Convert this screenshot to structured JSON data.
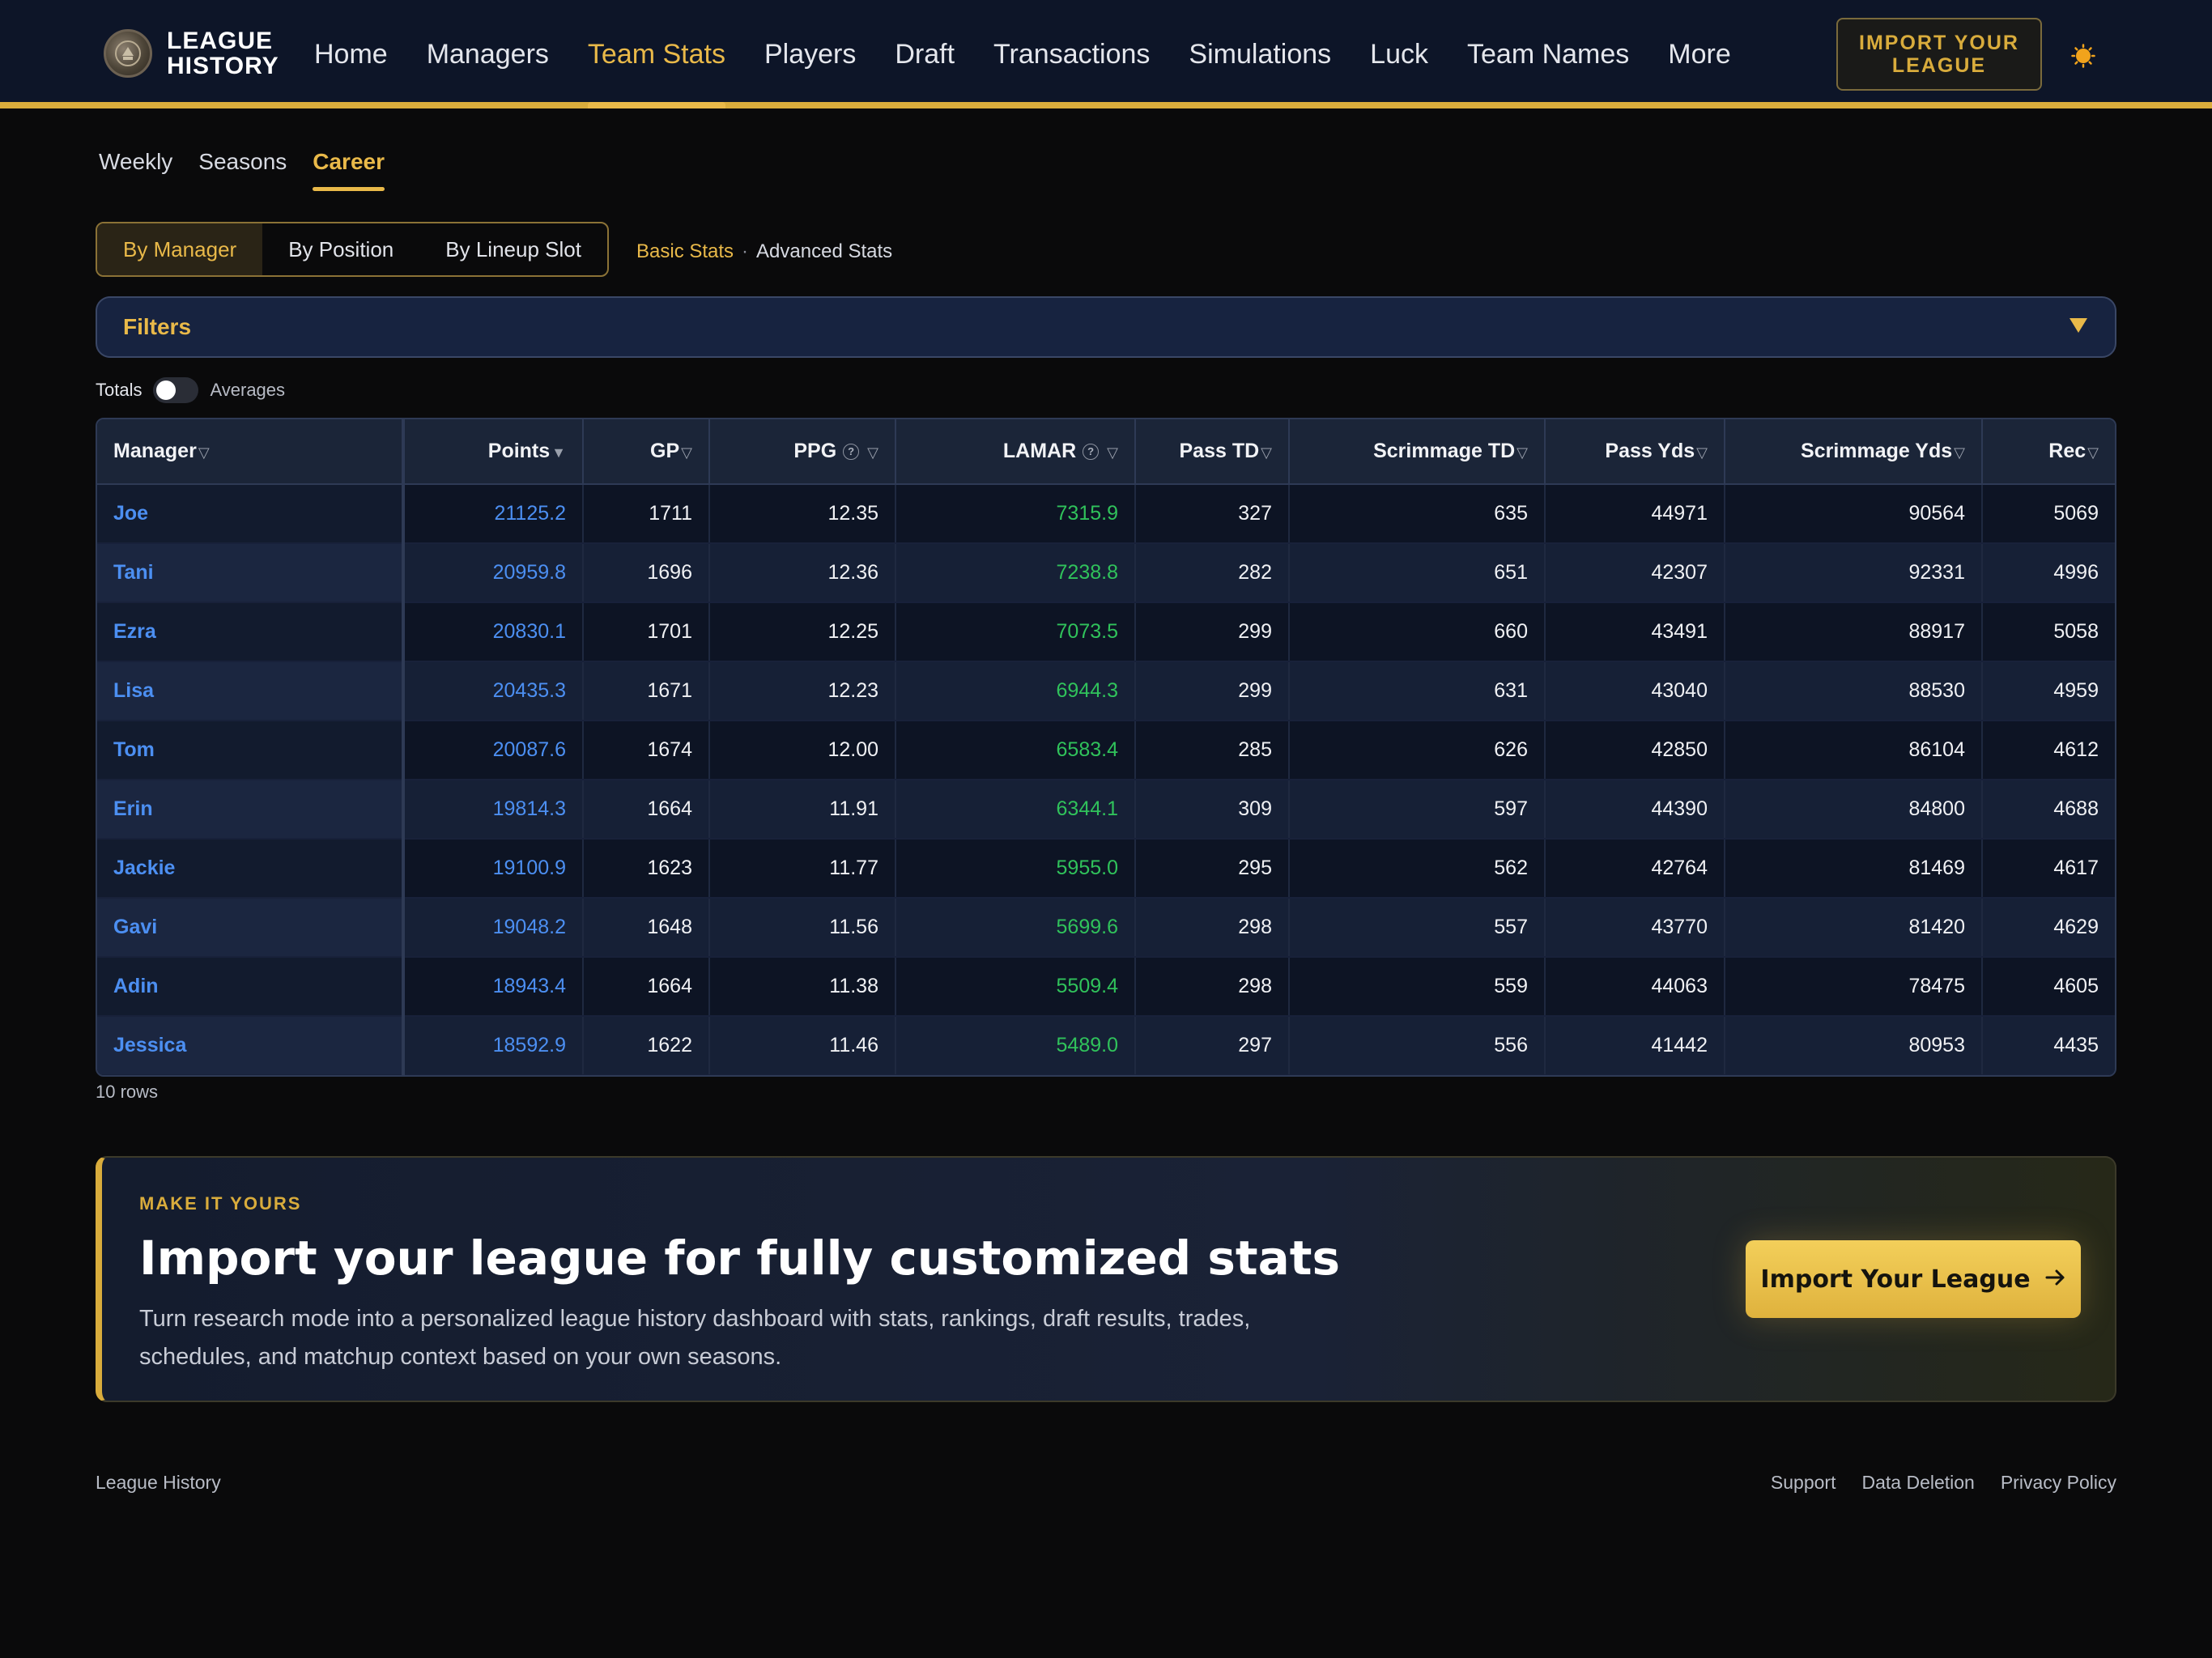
{
  "brand": {
    "name": "LEAGUE HISTORY",
    "logo_icon": "seal-logo-icon"
  },
  "nav": {
    "links": [
      "Home",
      "Managers",
      "Team Stats",
      "Players",
      "Draft",
      "Transactions",
      "Simulations",
      "Luck",
      "Team Names",
      "More"
    ],
    "active": "Team Stats",
    "import_label": "IMPORT YOUR LEAGUE",
    "theme_icon": "sun-icon"
  },
  "subtabs": {
    "items": [
      "Weekly",
      "Seasons",
      "Career"
    ],
    "active": "Career"
  },
  "segment": {
    "items": [
      "By Manager",
      "By Position",
      "By Lineup Slot"
    ],
    "active": "By Manager"
  },
  "stat_links": {
    "basic": "Basic Stats",
    "separator": "·",
    "advanced": "Advanced Stats",
    "active": "Basic Stats"
  },
  "filters": {
    "label": "Filters",
    "icon": "caret-down-icon"
  },
  "toggle": {
    "left": "Totals",
    "right": "Averages",
    "state": "Totals"
  },
  "table": {
    "headers": [
      "Manager",
      "Points",
      "GP",
      "PPG",
      "LAMAR",
      "Pass TD",
      "Scrimmage TD",
      "Pass Yds",
      "Scrimmage Yds",
      "Rec"
    ],
    "rows": [
      [
        "Joe",
        "21125.2",
        "1711",
        "12.35",
        "7315.9",
        "327",
        "635",
        "44971",
        "90564",
        "5069"
      ],
      [
        "Tani",
        "20959.8",
        "1696",
        "12.36",
        "7238.8",
        "282",
        "651",
        "42307",
        "92331",
        "4996"
      ],
      [
        "Ezra",
        "20830.1",
        "1701",
        "12.25",
        "7073.5",
        "299",
        "660",
        "43491",
        "88917",
        "5058"
      ],
      [
        "Lisa",
        "20435.3",
        "1671",
        "12.23",
        "6944.3",
        "299",
        "631",
        "43040",
        "88530",
        "4959"
      ],
      [
        "Tom",
        "20087.6",
        "1674",
        "12.00",
        "6583.4",
        "285",
        "626",
        "42850",
        "86104",
        "4612"
      ],
      [
        "Erin",
        "19814.3",
        "1664",
        "11.91",
        "6344.1",
        "309",
        "597",
        "44390",
        "84800",
        "4688"
      ],
      [
        "Jackie",
        "19100.9",
        "1623",
        "11.77",
        "5955.0",
        "295",
        "562",
        "42764",
        "81469",
        "4617"
      ],
      [
        "Gavi",
        "19048.2",
        "1648",
        "11.56",
        "5699.6",
        "298",
        "557",
        "43770",
        "81420",
        "4629"
      ],
      [
        "Adin",
        "18943.4",
        "1664",
        "11.38",
        "5509.4",
        "298",
        "559",
        "44063",
        "78475",
        "4605"
      ],
      [
        "Jessica",
        "18592.9",
        "1622",
        "11.46",
        "5489.0",
        "297",
        "556",
        "41442",
        "80953",
        "4435"
      ]
    ],
    "row_count": "10 rows"
  },
  "cta": {
    "kicker": "MAKE IT YOURS",
    "title": "Import your league for fully customized stats",
    "description": "Turn research mode into a personalized league history dashboard with stats, rankings, draft results, trades, schedules, and matchup context based on your own seasons.",
    "button": "Import Your League",
    "button_icon": "arrow-right-icon"
  },
  "footer": {
    "brand": "League History",
    "links": [
      "Support",
      "Data Deletion",
      "Privacy Policy"
    ]
  },
  "colors": {
    "accent": "#e9b949",
    "link_blue": "#4c8ff2",
    "positive_green": "#30c25b",
    "nav_bg": "#0d1528"
  }
}
